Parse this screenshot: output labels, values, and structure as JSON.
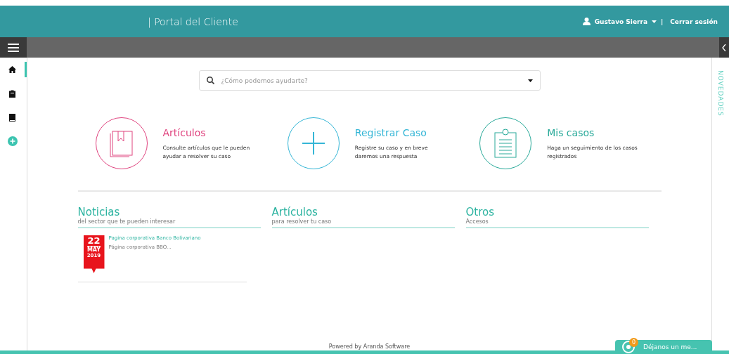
{
  "header": {
    "title": "| Portal del Cliente",
    "user": "Gustavo Sierra",
    "separator": "|",
    "logout": "Cerrar sesión"
  },
  "sidebar": {
    "items": [
      {
        "kind": "home",
        "selected": true
      },
      {
        "kind": "clipboard",
        "selected": false
      },
      {
        "kind": "book",
        "selected": false
      },
      {
        "kind": "add",
        "selected": false
      }
    ]
  },
  "right_panel": {
    "label": "NOVEDADES"
  },
  "search": {
    "placeholder": "¿Cómo podemos ayudarte?"
  },
  "actions": [
    {
      "kind": "book",
      "title": "Artículos",
      "text": "Consulte artículos que le pueden ayudar a resolver su caso",
      "color": "#e0447f"
    },
    {
      "kind": "plus",
      "title": "Registrar Caso",
      "text": "Registre su caso y en breve daremos una respuesta",
      "color": "#35b6d6"
    },
    {
      "kind": "clipboard",
      "title": "Mis casos",
      "text": "Haga un seguimiento de los casos registrados",
      "color": "#2aaa9a"
    }
  ],
  "sections": [
    {
      "title": "Noticias",
      "subtitle": "del sector que te pueden interesar",
      "items": [
        {
          "day": "22",
          "month": "MAY",
          "year": "2019",
          "title": "Pagina corporativa Banco Bolivariano",
          "text": "Página corporativa BBO..."
        }
      ]
    },
    {
      "title": "Artículos",
      "subtitle": "para resolver tu caso"
    },
    {
      "title": "Otros",
      "subtitle": "Accesos"
    }
  ],
  "footer": {
    "text": "Powered by Aranda Software"
  },
  "chat": {
    "badge": "0",
    "label": "Déjanos un me..."
  }
}
